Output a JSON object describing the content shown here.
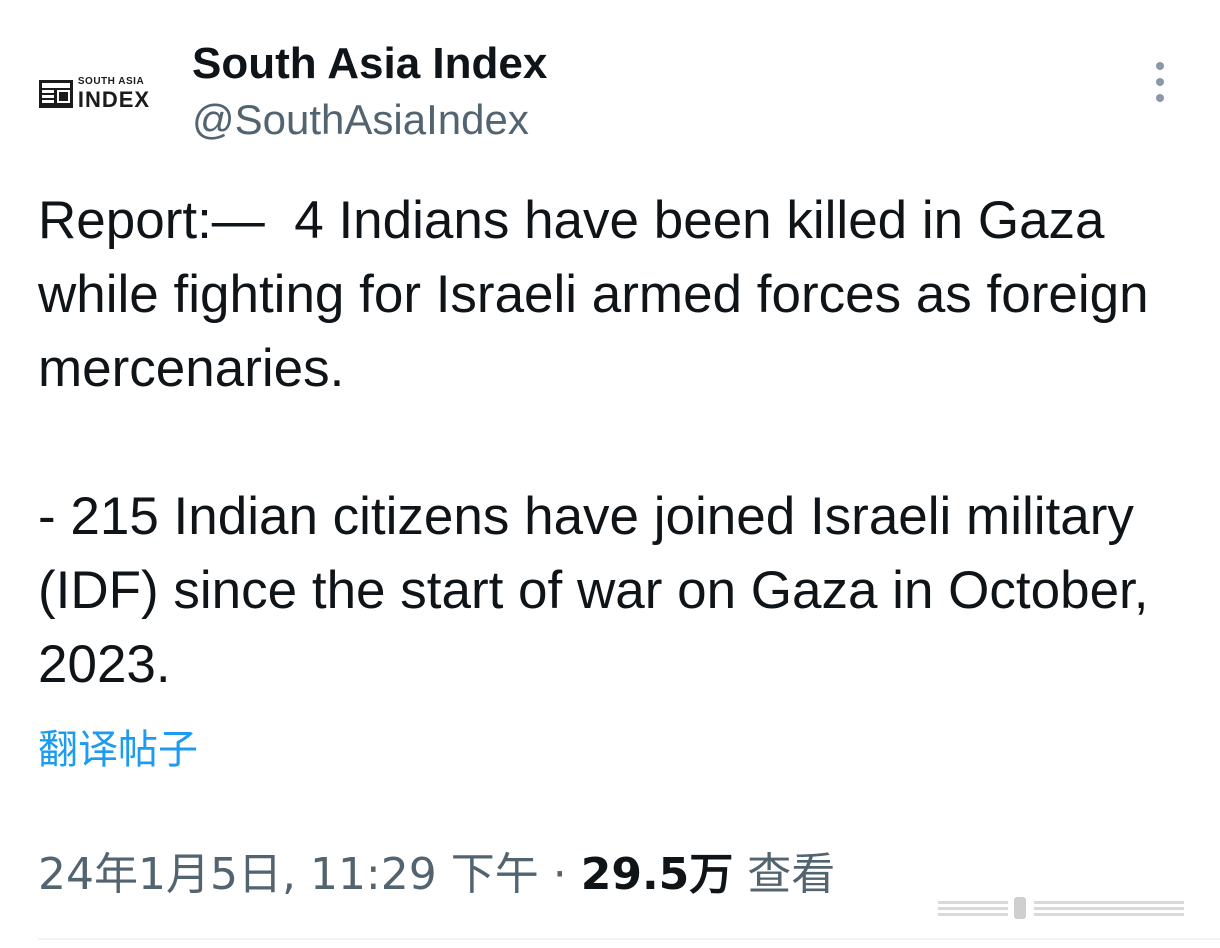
{
  "author": {
    "logo_top": "SOUTH ASIA",
    "logo_bottom": "INDEX",
    "display_name": "South Asia Index",
    "handle": "@SouthAsiaIndex"
  },
  "tweet": {
    "paragraphs": [
      "Report:—  4 Indians have been killed in Gaza while fighting for Israeli armed forces as foreign mercenaries.",
      "- 215 Indian citizens have joined Israeli military (IDF) since the start of war on Gaza in October, 2023."
    ],
    "translate_label": "翻译帖子"
  },
  "meta": {
    "timestamp": "24年1月5日, 11:29 下午",
    "separator": " · ",
    "views_count": "29.5万",
    "views_label": " 查看"
  },
  "icons": {
    "more": "more-vertical-icon"
  },
  "colors": {
    "link": "#1d9bf0",
    "secondary_text": "#536471",
    "primary_text": "#0f1419"
  }
}
